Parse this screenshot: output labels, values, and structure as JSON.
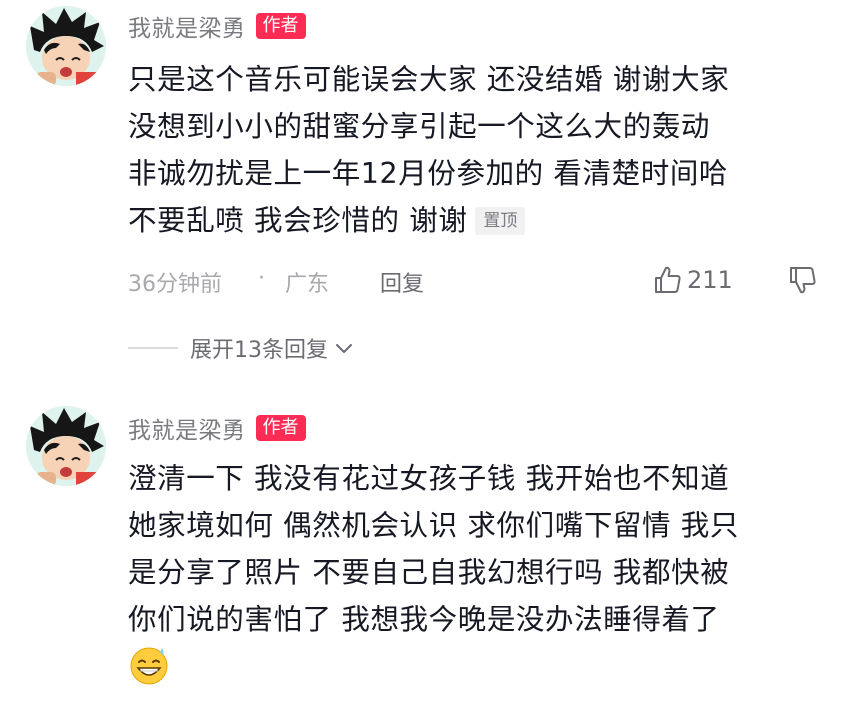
{
  "comments": [
    {
      "author": "我就是梁勇",
      "badge": "作者",
      "lines": [
        "只是这个音乐可能误会大家 还没结婚 谢谢大家",
        "没想到小小的甜蜜分享引起一个这么大的轰动",
        "非诚勿扰是上一年12月份参加的 看清楚时间哈",
        "不要乱喷 我会珍惜的 谢谢"
      ],
      "pinned_label": "置顶",
      "time": "36分钟前",
      "separator": "·",
      "location": "广东",
      "reply_label": "回复",
      "like_count": "211",
      "expand_label": "展开13条回复"
    },
    {
      "author": "我就是梁勇",
      "badge": "作者",
      "lines": [
        "澄清一下 我没有花过女孩子钱 我开始也不知道",
        "她家境如何 偶然机会认识 求你们嘴下留情 我只",
        "是分享了照片 不要自己自我幻想行吗 我都快被",
        "你们说的害怕了 我想我今晚是没办法睡得着了"
      ],
      "emoji": "sweat-smile-emoji"
    }
  ],
  "colors": {
    "badge": "#fe2c55",
    "meta": "#a8a9ad",
    "body": "#161823"
  },
  "icons": {
    "like": "thumbs-up-icon",
    "dislike": "thumbs-down-icon",
    "expand": "chevron-down-icon"
  }
}
